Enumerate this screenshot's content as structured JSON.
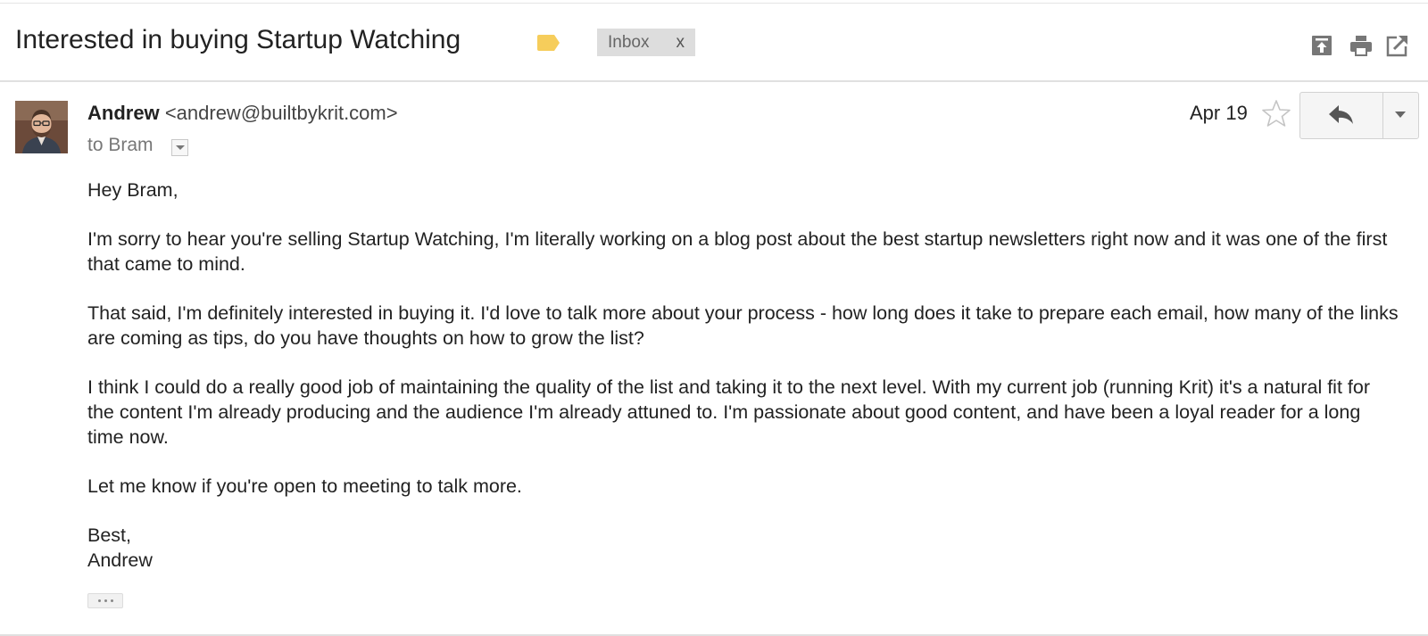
{
  "thread": {
    "subject": "Interested in buying Startup Watching",
    "label_chip": "Inbox",
    "label_remove": "x",
    "label_color": "#f6cd5b",
    "actions": [
      "archive-icon",
      "print-icon",
      "new-window-icon"
    ]
  },
  "message": {
    "sender_name": "Andrew",
    "sender_email": "<andrew@builtbykrit.com>",
    "recipient": "to Bram",
    "date": "Apr 19",
    "starred": false,
    "body": [
      "Hey Bram,",
      "I'm sorry to hear you're selling Startup Watching, I'm literally working on a blog post about the best startup newsletters right now and it was one of the first that came to mind.",
      "That said, I'm definitely interested in buying it. I'd love to talk more about your process - how long does it take to prepare each email, how many of the links are coming as tips, do you have thoughts on how to grow the list?",
      "I think I could do a really good job of maintaining the quality of the list and taking it to the next level. With my current job (running Krit) it's a natural fit for the content I'm already producing and the audience I'm already attuned to. I'm passionate about good content, and have been a loyal reader for a long time now.",
      "Let me know if you're open to meeting to talk more."
    ],
    "signoff": "Best,",
    "signature": "Andrew"
  }
}
